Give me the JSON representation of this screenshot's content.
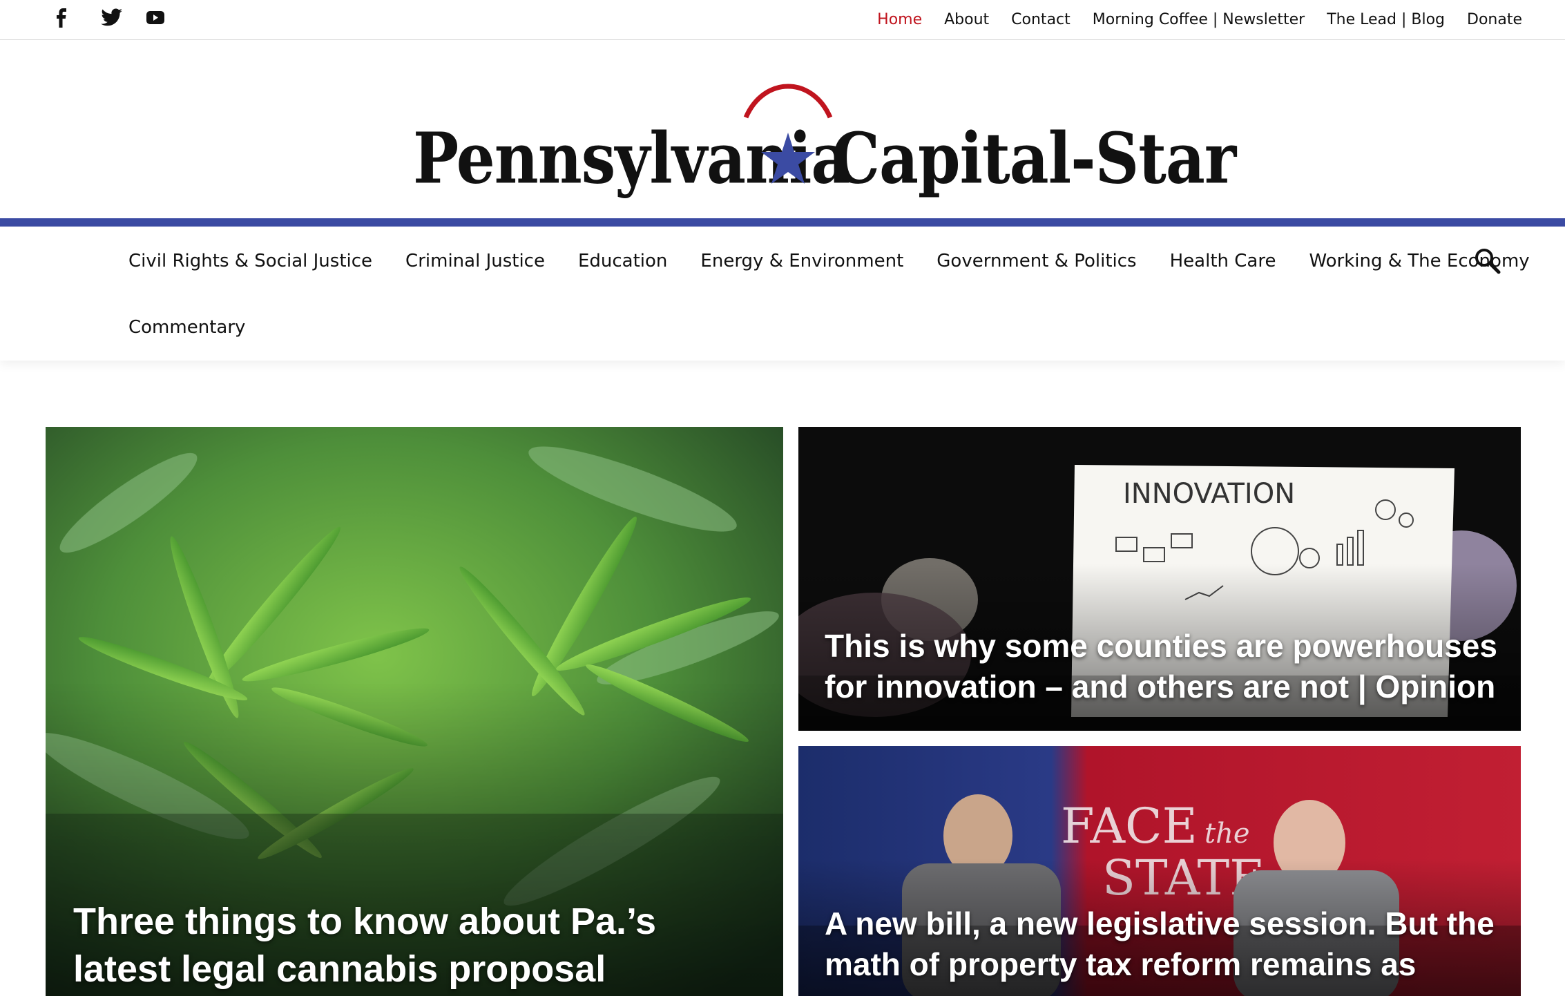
{
  "social": {
    "icons": [
      "facebook-icon",
      "twitter-icon",
      "youtube-icon"
    ]
  },
  "topnav": {
    "items": [
      "Home",
      "About",
      "Contact",
      "Morning Coffee | Newsletter",
      "The Lead | Blog",
      "Donate"
    ],
    "active": "Home"
  },
  "logo": {
    "word1": "Pennsylvania",
    "word2": "Capital-Star",
    "star_color": "#3b4ba3",
    "arc_color": "#c0141e"
  },
  "colors": {
    "accent_red": "#c0141e",
    "band_blue": "#3b4ba3"
  },
  "catnav": {
    "items": [
      "Civil Rights & Social Justice",
      "Criminal Justice",
      "Education",
      "Energy & Environment",
      "Government & Politics",
      "Health Care",
      "Working & The Economy"
    ],
    "row2": [
      "Commentary"
    ],
    "search_icon": "search-icon"
  },
  "stories": [
    {
      "headline": "Three things to know about Pa.’s latest legal cannabis proposal",
      "image": "cannabis-plant-photo"
    },
    {
      "headline": "This is why some counties are powerhouses for innovation – and others are not | Opinion",
      "image": "innovation-sketch-photo"
    },
    {
      "headline": "A new bill, a new legislative session. But the math of property tax reform remains as",
      "image": "face-the-state-tv-photo"
    }
  ]
}
